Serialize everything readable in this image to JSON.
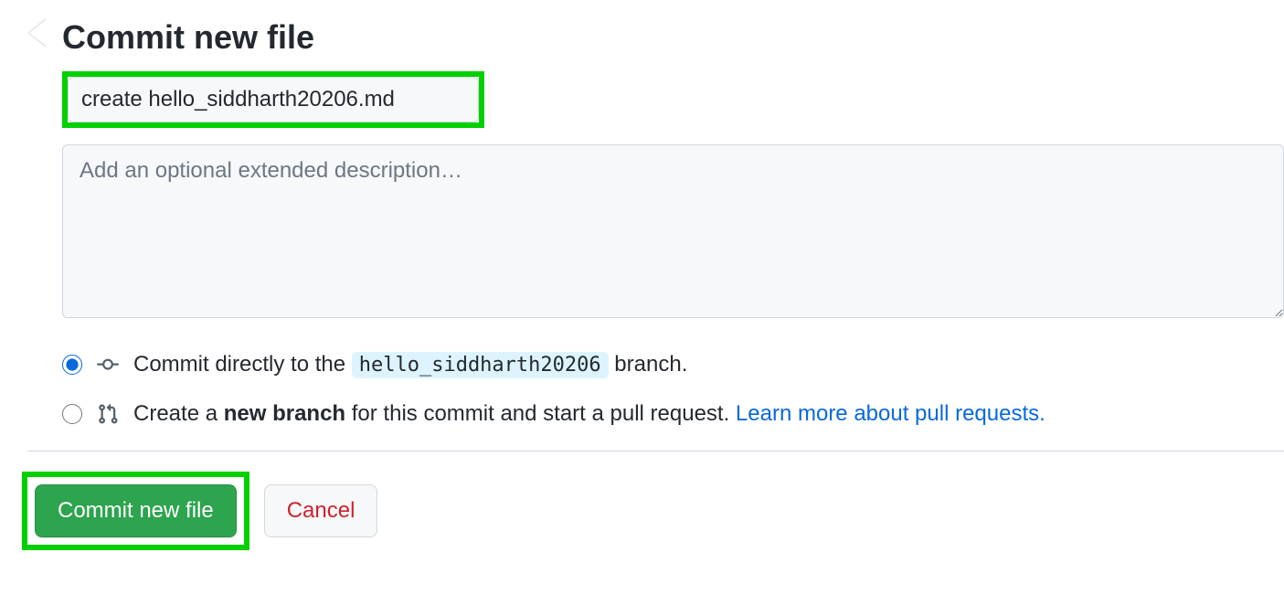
{
  "header": {
    "title": "Commit new file"
  },
  "form": {
    "summary_value": "create hello_siddharth20206.md",
    "description_placeholder": "Add an optional extended description…"
  },
  "branch_options": {
    "direct": {
      "prefix": "Commit directly to the ",
      "branch_name": "hello_siddharth20206",
      "suffix": " branch."
    },
    "new_branch": {
      "text_before_bold": "Create a ",
      "bold_text": "new branch",
      "text_after_bold": " for this commit and start a pull request. ",
      "link_text": "Learn more about pull requests."
    }
  },
  "actions": {
    "commit_label": "Commit new file",
    "cancel_label": "Cancel"
  }
}
